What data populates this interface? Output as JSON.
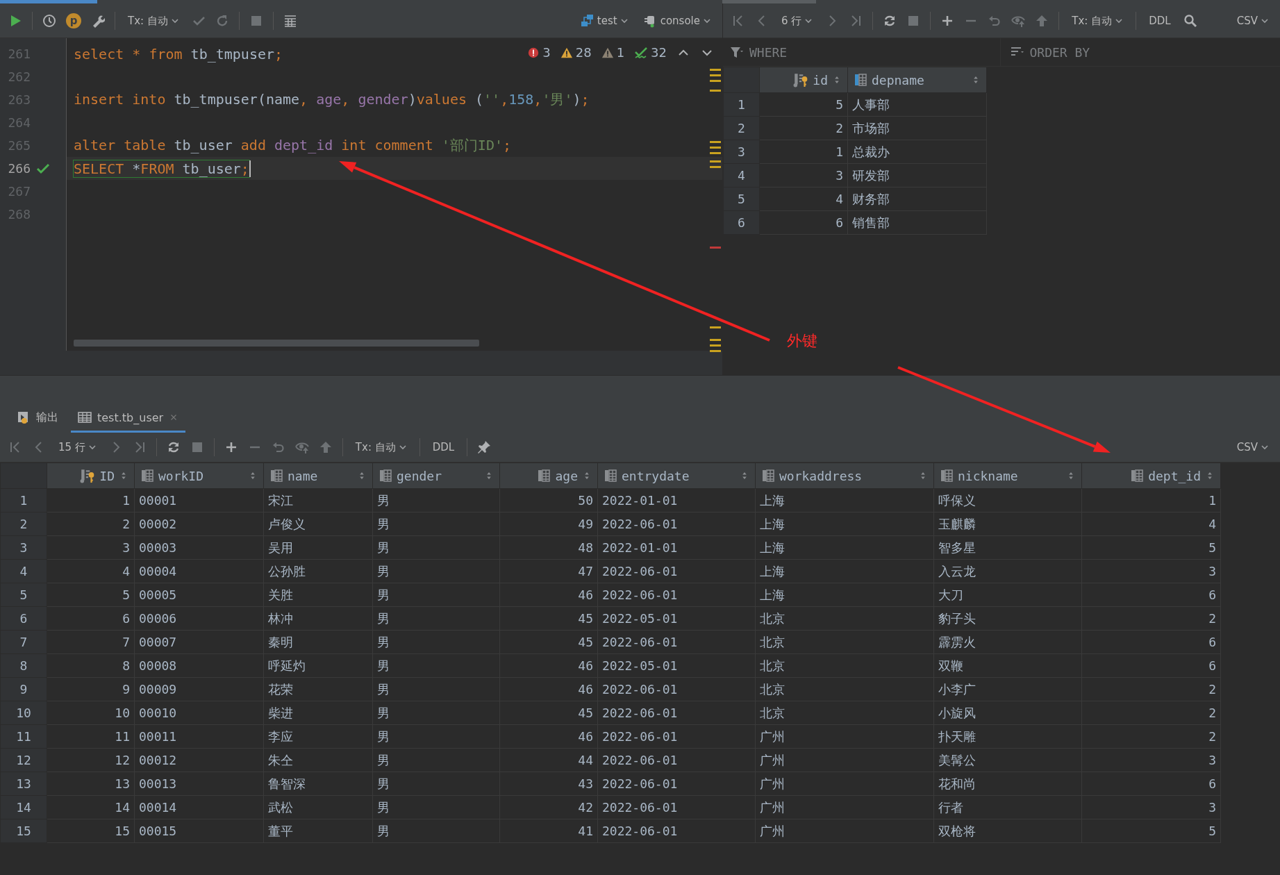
{
  "editor_toolbar": {
    "session_badge": "p",
    "tx_mode": "Tx: 自动",
    "datasource": "test",
    "console": "console"
  },
  "editor": {
    "lines": [
      {
        "number": "261",
        "current": false,
        "executed": false,
        "tokens": [
          {
            "kind": "keyword",
            "text": "select"
          },
          {
            "kind": "keyword",
            "text": " * "
          },
          {
            "kind": "keyword",
            "text": "from"
          },
          {
            "kind": "plain",
            "text": " tb_tmpuser"
          },
          {
            "kind": "keyword",
            "text": ";"
          }
        ]
      },
      {
        "number": "262",
        "current": false,
        "executed": false
      },
      {
        "number": "263",
        "current": false,
        "executed": false,
        "tokens": [
          {
            "kind": "keyword",
            "text": "insert into"
          },
          {
            "kind": "plain",
            "text": " tb_tmpuser(name"
          },
          {
            "kind": "keyword",
            "text": ", "
          },
          {
            "kind": "column",
            "text": "age"
          },
          {
            "kind": "keyword",
            "text": ", "
          },
          {
            "kind": "column",
            "text": "gender"
          },
          {
            "kind": "plain",
            "text": ")"
          },
          {
            "kind": "keyword",
            "text": "values"
          },
          {
            "kind": "plain",
            "text": " ("
          },
          {
            "kind": "string",
            "text": "''"
          },
          {
            "kind": "keyword",
            "text": ","
          },
          {
            "kind": "number",
            "text": "158"
          },
          {
            "kind": "keyword",
            "text": ","
          },
          {
            "kind": "string",
            "text": "'男'"
          },
          {
            "kind": "plain",
            "text": ")"
          },
          {
            "kind": "keyword",
            "text": ";"
          }
        ]
      },
      {
        "number": "264",
        "current": false,
        "executed": false
      },
      {
        "number": "265",
        "current": false,
        "executed": false,
        "tokens": [
          {
            "kind": "keyword",
            "text": "alter table"
          },
          {
            "kind": "plain",
            "text": " tb_user "
          },
          {
            "kind": "keyword",
            "text": "add"
          },
          {
            "kind": "column",
            "text": " dept_id"
          },
          {
            "kind": "keyword",
            "text": " int comment"
          },
          {
            "kind": "string",
            "text": " '部门ID'"
          },
          {
            "kind": "keyword",
            "text": ";"
          }
        ]
      },
      {
        "number": "266",
        "current": true,
        "executed": true,
        "tokens": [
          {
            "kind": "keyword",
            "text": "SELECT"
          },
          {
            "kind": "plain",
            "text": " *"
          },
          {
            "kind": "keyword",
            "text": "FROM"
          },
          {
            "kind": "plain",
            "text": " tb_user"
          },
          {
            "kind": "keyword",
            "text": ";"
          }
        ]
      },
      {
        "number": "267",
        "current": false,
        "executed": false
      },
      {
        "number": "268",
        "current": false,
        "executed": false
      }
    ],
    "inspections": [
      {
        "kind": "error",
        "count": "3"
      },
      {
        "kind": "warning",
        "count": "28"
      },
      {
        "kind": "weak_warning",
        "count": "1"
      },
      {
        "kind": "typo",
        "count": "32"
      }
    ]
  },
  "result_panel": {
    "toolbar": {
      "rows": "6 行",
      "tx_mode": "Tx: 自动",
      "ddl": "DDL",
      "export": "CSV"
    },
    "filter": {
      "where_placeholder": "WHERE",
      "order_placeholder": "ORDER BY"
    },
    "table": {
      "columns": [
        {
          "name": "id",
          "kind": "number",
          "primary_key": true
        },
        {
          "name": "depname",
          "kind": "text",
          "primary_key": false
        }
      ],
      "rows": [
        {
          "row_number": "1",
          "cells": [
            "5",
            "人事部"
          ]
        },
        {
          "row_number": "2",
          "cells": [
            "2",
            "市场部"
          ]
        },
        {
          "row_number": "3",
          "cells": [
            "1",
            "总裁办"
          ]
        },
        {
          "row_number": "4",
          "cells": [
            "3",
            "研发部"
          ]
        },
        {
          "row_number": "5",
          "cells": [
            "4",
            "财务部"
          ]
        },
        {
          "row_number": "6",
          "cells": [
            "6",
            "销售部"
          ]
        }
      ]
    }
  },
  "annotation": {
    "text": "外键"
  },
  "bottom_panel": {
    "tabs": [
      {
        "label": "输出",
        "selected": false,
        "closable": false
      },
      {
        "label": "test.tb_user",
        "selected": true,
        "closable": true
      }
    ],
    "toolbar": {
      "rows": "15 行",
      "tx_mode": "Tx: 自动",
      "ddl": "DDL",
      "export": "CSV"
    },
    "table": {
      "columns": [
        {
          "name": "ID",
          "kind": "number",
          "primary_key": true
        },
        {
          "name": "workID",
          "kind": "text",
          "primary_key": false
        },
        {
          "name": "name",
          "kind": "text",
          "primary_key": false
        },
        {
          "name": "gender",
          "kind": "text",
          "primary_key": false
        },
        {
          "name": "age",
          "kind": "number",
          "primary_key": false
        },
        {
          "name": "entrydate",
          "kind": "text",
          "primary_key": false
        },
        {
          "name": "workaddress",
          "kind": "text",
          "primary_key": false
        },
        {
          "name": "nickname",
          "kind": "text",
          "primary_key": false
        },
        {
          "name": "dept_id",
          "kind": "number",
          "primary_key": false
        }
      ],
      "rows": [
        {
          "row_number": "1",
          "cells": [
            "1",
            "00001",
            "宋江",
            "男",
            "50",
            "2022-01-01",
            "上海",
            "呼保义",
            "1"
          ]
        },
        {
          "row_number": "2",
          "cells": [
            "2",
            "00002",
            "卢俊义",
            "男",
            "49",
            "2022-06-01",
            "上海",
            "玉麒麟",
            "4"
          ]
        },
        {
          "row_number": "3",
          "cells": [
            "3",
            "00003",
            "吴用",
            "男",
            "48",
            "2022-01-01",
            "上海",
            "智多星",
            "5"
          ]
        },
        {
          "row_number": "4",
          "cells": [
            "4",
            "00004",
            "公孙胜",
            "男",
            "47",
            "2022-06-01",
            "上海",
            "入云龙",
            "3"
          ]
        },
        {
          "row_number": "5",
          "cells": [
            "5",
            "00005",
            "关胜",
            "男",
            "46",
            "2022-06-01",
            "上海",
            "大刀",
            "6"
          ]
        },
        {
          "row_number": "6",
          "cells": [
            "6",
            "00006",
            "林冲",
            "男",
            "45",
            "2022-05-01",
            "北京",
            "豹子头",
            "2"
          ]
        },
        {
          "row_number": "7",
          "cells": [
            "7",
            "00007",
            "秦明",
            "男",
            "45",
            "2022-06-01",
            "北京",
            "霹雳火",
            "6"
          ]
        },
        {
          "row_number": "8",
          "cells": [
            "8",
            "00008",
            "呼延灼",
            "男",
            "46",
            "2022-05-01",
            "北京",
            "双鞭",
            "6"
          ]
        },
        {
          "row_number": "9",
          "cells": [
            "9",
            "00009",
            "花荣",
            "男",
            "46",
            "2022-06-01",
            "北京",
            "小李广",
            "2"
          ]
        },
        {
          "row_number": "10",
          "cells": [
            "10",
            "00010",
            "柴进",
            "男",
            "45",
            "2022-06-01",
            "北京",
            "小旋风",
            "2"
          ]
        },
        {
          "row_number": "11",
          "cells": [
            "11",
            "00011",
            "李应",
            "男",
            "46",
            "2022-06-01",
            "广州",
            "扑天雕",
            "2"
          ]
        },
        {
          "row_number": "12",
          "cells": [
            "12",
            "00012",
            "朱仝",
            "男",
            "44",
            "2022-06-01",
            "广州",
            "美髯公",
            "3"
          ]
        },
        {
          "row_number": "13",
          "cells": [
            "13",
            "00013",
            "鲁智深",
            "男",
            "43",
            "2022-06-01",
            "广州",
            "花和尚",
            "6"
          ]
        },
        {
          "row_number": "14",
          "cells": [
            "14",
            "00014",
            "武松",
            "男",
            "42",
            "2022-06-01",
            "广州",
            "行者",
            "3"
          ]
        },
        {
          "row_number": "15",
          "cells": [
            "15",
            "00015",
            "董平",
            "男",
            "41",
            "2022-06-01",
            "广州",
            "双枪将",
            "5"
          ]
        }
      ]
    }
  }
}
